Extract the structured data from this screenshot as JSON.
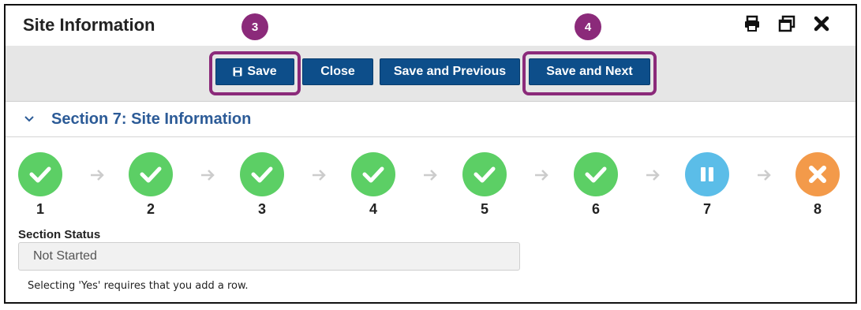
{
  "window": {
    "title": "Site Information",
    "icons": [
      "print-icon",
      "restore-icon",
      "close-icon"
    ]
  },
  "toolbar": {
    "save_label": "Save",
    "close_label": "Close",
    "save_prev_label": "Save and Previous",
    "save_next_label": "Save and Next"
  },
  "callouts": [
    "3",
    "4"
  ],
  "section": {
    "title": "Section 7: Site Information"
  },
  "steps": [
    {
      "num": "1",
      "state": "complete"
    },
    {
      "num": "2",
      "state": "complete"
    },
    {
      "num": "3",
      "state": "complete"
    },
    {
      "num": "4",
      "state": "complete"
    },
    {
      "num": "5",
      "state": "complete"
    },
    {
      "num": "6",
      "state": "complete"
    },
    {
      "num": "7",
      "state": "in-progress"
    },
    {
      "num": "8",
      "state": "error"
    }
  ],
  "form": {
    "status_label": "Section Status",
    "status_value": "Not Started",
    "note": "Selecting 'Yes' requires that you add a row."
  },
  "colors": {
    "primary": "#0d4e8a",
    "callout": "#8b2a7a",
    "complete": "#5ccf65",
    "in_progress": "#5bbde8",
    "error": "#f39a4a",
    "section_title": "#2c5b97"
  }
}
